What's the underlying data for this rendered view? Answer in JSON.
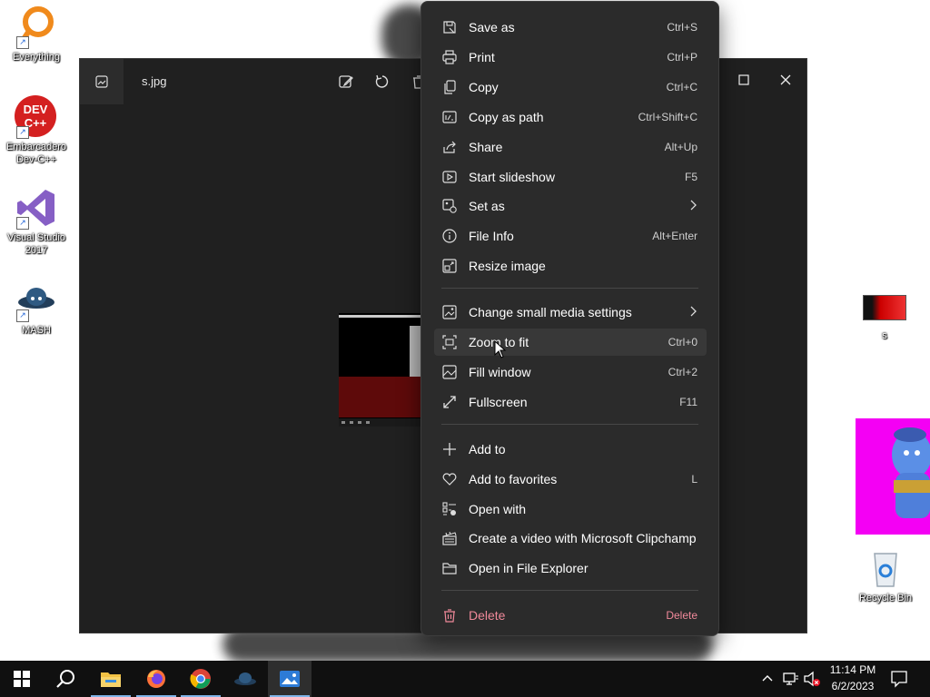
{
  "desktop": {
    "icons": [
      {
        "label": "Everything"
      },
      {
        "label": "Embarcadero Dev-C++"
      },
      {
        "label": "Visual Studio 2017"
      },
      {
        "label": "MASH"
      },
      {
        "label": "s"
      },
      {
        "label": "Recycle Bin"
      }
    ],
    "devcpp_badge": "DEV C++"
  },
  "photos": {
    "filename": "s.jpg"
  },
  "menu": {
    "items": [
      {
        "label": "Save as",
        "shortcut": "Ctrl+S",
        "icon": "save-as-icon"
      },
      {
        "label": "Print",
        "shortcut": "Ctrl+P",
        "icon": "print-icon"
      },
      {
        "label": "Copy",
        "shortcut": "Ctrl+C",
        "icon": "copy-icon"
      },
      {
        "label": "Copy as path",
        "shortcut": "Ctrl+Shift+C",
        "icon": "copy-path-icon"
      },
      {
        "label": "Share",
        "shortcut": "Alt+Up",
        "icon": "share-icon"
      },
      {
        "label": "Start slideshow",
        "shortcut": "F5",
        "icon": "slideshow-icon"
      },
      {
        "label": "Set as",
        "shortcut": "",
        "icon": "set-as-icon"
      },
      {
        "label": "File Info",
        "shortcut": "Alt+Enter",
        "icon": "info-icon"
      },
      {
        "label": "Resize image",
        "shortcut": "",
        "icon": "resize-icon"
      },
      {
        "label": "Change small media settings",
        "shortcut": "",
        "icon": "media-settings-icon"
      },
      {
        "label": "Zoom to fit",
        "shortcut": "Ctrl+0",
        "icon": "zoom-fit-icon"
      },
      {
        "label": "Fill window",
        "shortcut": "Ctrl+2",
        "icon": "fill-window-icon"
      },
      {
        "label": "Fullscreen",
        "shortcut": "F11",
        "icon": "fullscreen-icon"
      },
      {
        "label": "Add to",
        "shortcut": "",
        "icon": "plus-icon"
      },
      {
        "label": "Add to favorites",
        "shortcut": "L",
        "icon": "heart-icon"
      },
      {
        "label": "Open with",
        "shortcut": "",
        "icon": "open-with-icon"
      },
      {
        "label": "Create a video with Microsoft Clipchamp",
        "shortcut": "",
        "icon": "clipchamp-icon"
      },
      {
        "label": "Open in File Explorer",
        "shortcut": "",
        "icon": "folder-icon"
      },
      {
        "label": "Delete",
        "shortcut": "Delete",
        "icon": "trash-icon"
      }
    ]
  },
  "taskbar": {
    "time": "11:14 PM",
    "date": "6/2/2023"
  },
  "colors": {
    "menu_bg": "#2b2b2b",
    "danger": "#f0899a",
    "taskbar_bg": "#101010"
  }
}
